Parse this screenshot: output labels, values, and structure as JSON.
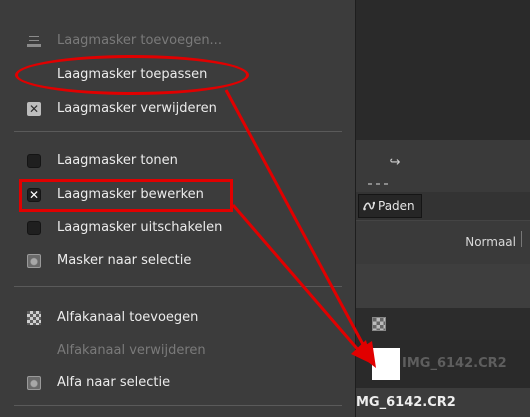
{
  "menu": {
    "items": [
      {
        "label": "Laagmasker toevoegen...",
        "icon": "add-mask-icon",
        "enabled": false
      },
      {
        "label": "Laagmasker toepassen",
        "icon": "",
        "enabled": true
      },
      {
        "label": "Laagmasker verwijderen",
        "icon": "x-box-icon",
        "enabled": true
      },
      {
        "label": "Laagmasker tonen",
        "icon": "checkbox-icon",
        "checked": false
      },
      {
        "label": "Laagmasker bewerken",
        "icon": "checkbox-icon",
        "checked": true
      },
      {
        "label": "Laagmasker uitschakelen",
        "icon": "checkbox-icon",
        "checked": false
      },
      {
        "label": "Masker naar selectie",
        "icon": "mask-selection-icon",
        "enabled": true
      },
      {
        "label": "Alfakanaal toevoegen",
        "icon": "checkerboard-icon",
        "enabled": true
      },
      {
        "label": "Alfakanaal verwijderen",
        "icon": "",
        "enabled": false
      },
      {
        "label": "Alfa naar selectie",
        "icon": "mask-selection-icon",
        "enabled": true
      }
    ]
  },
  "panel": {
    "tab_paths": "Paden",
    "mode": "Normaal",
    "layer_name_ghost": "IMG_6142.CR2",
    "layer_name": "MG_6142.CR2"
  },
  "highlight_color": "#e10000"
}
